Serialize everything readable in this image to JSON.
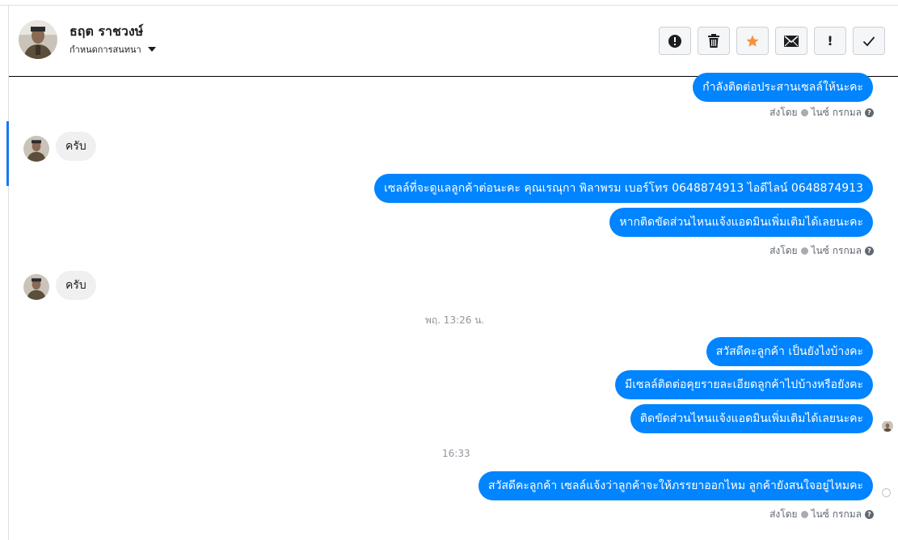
{
  "header": {
    "name": "ธฤต ราชวงษ์",
    "subtitle": "กำหนดการสนทนา",
    "tools": [
      {
        "icon": "alert-circle-icon"
      },
      {
        "icon": "trash-icon"
      },
      {
        "icon": "star-icon",
        "color": "#f7923b"
      },
      {
        "icon": "mail-icon"
      },
      {
        "icon": "exclamation-icon",
        "label": "!"
      },
      {
        "icon": "checkmark-icon"
      }
    ]
  },
  "messages": {
    "m1": "กำลังติดต่อประสานเซลล์ให้นะคะ",
    "sent1": "ส่งโดย",
    "sender1": "ไนซ์ กรกมล",
    "in1": "ครับ",
    "m2": "เซลล์ที่จะดูแลลูกค้าต่อนะคะ คุณเรณุกา พิลาพรม        เบอร์โทร 0648874913  ไอดีไลน์ 0648874913",
    "m3": "หากติดขัดส่วนไหนแจ้งแอดมินเพิ่มเติมได้เลยนะคะ",
    "sent2": "ส่งโดย",
    "sender2": "ไนซ์ กรกมล",
    "in2": "ครับ",
    "time1": "พฤ. 13:26 น.",
    "m4": "สวัสดีคะลูกค้า เป็นยังไงบ้างคะ",
    "m5": "มีเซลล์ติดต่อคุยรายละเอียดลูกค้าไปบ้างหรือยังคะ",
    "m6": "ติดขัดส่วนไหนแจ้งแอดมินเพิ่มเติมได้เลยนะคะ",
    "time2": "16:33",
    "m7": "สวัสดีคะลูกค้า เซลล์แจ้งว่าลูกค้าจะให้ภรรยาออกไหม ลูกค้ายังสนใจอยู่ไหมคะ",
    "sent3": "ส่งโดย",
    "sender3": "ไนซ์ กรกมล"
  },
  "colors": {
    "outgoing": "#0084ff",
    "incoming": "#f0f0f0",
    "accent": "#1877f2"
  }
}
